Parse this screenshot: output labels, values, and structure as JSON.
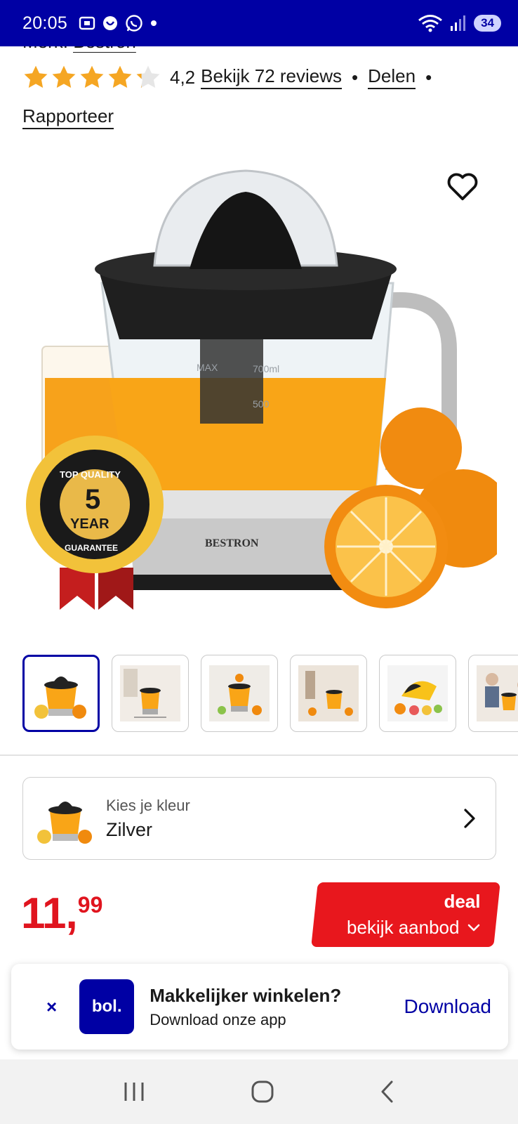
{
  "status_bar": {
    "time": "20:05",
    "battery": "34",
    "wifi_badge": "6"
  },
  "product": {
    "brand_prefix": "Merk:",
    "brand": "Bestron",
    "rating_value": "4,2",
    "rating_stars": 4.2,
    "reviews_link": "Bekijk 72 reviews",
    "share_link": "Delen",
    "report_link": "Rapporteer",
    "separator": "•",
    "image": {
      "brand_logo_text": "BESTRON",
      "badge_top": "TOP QUALITY",
      "badge_number": "5",
      "badge_year": "YEAR",
      "badge_bottom": "GUARANTEE",
      "measure_max": "MAX",
      "measure_700": "700ml",
      "measure_500": "500"
    }
  },
  "thumbnails": [
    {
      "alt": "juicer-front",
      "active": true
    },
    {
      "alt": "juicer-kitchen-dimensions",
      "active": false
    },
    {
      "alt": "juicer-with-fruit",
      "active": false
    },
    {
      "alt": "juicer-in-use",
      "active": false
    },
    {
      "alt": "juicer-cone-fruits",
      "active": false
    },
    {
      "alt": "juicer-family",
      "active": false
    }
  ],
  "variant": {
    "label": "Kies je kleur",
    "value": "Zilver"
  },
  "price": {
    "integer": "11",
    "comma": ",",
    "cents": "99"
  },
  "deal": {
    "label": "deal",
    "cta": "bekijk aanbod"
  },
  "app_banner": {
    "close": "×",
    "logo": "bol.",
    "title": "Makkelijker winkelen?",
    "subtitle": "Download onze app",
    "download": "Download"
  },
  "colors": {
    "brand_blue": "#0000a4",
    "deal_red": "#e8171d",
    "price_red": "#e0141e",
    "star": "#f5a623"
  }
}
